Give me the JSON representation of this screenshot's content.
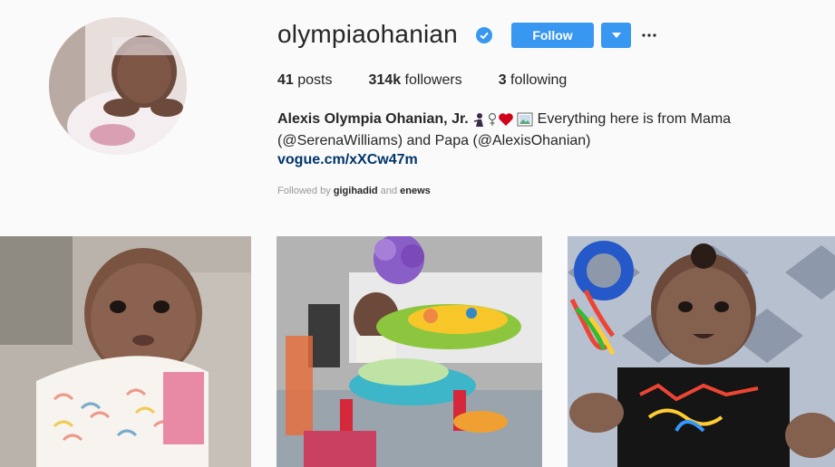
{
  "profile": {
    "username": "olympiaohanian",
    "follow_label": "Follow",
    "posts_count": "41",
    "posts_label": "posts",
    "followers_count": "314k",
    "followers_label": "followers",
    "following_count": "3",
    "following_label": "following",
    "full_name": "Alexis Olympia Ohanian, Jr.",
    "bio_line1": "Everything here is from Mama",
    "bio_line2": "(@SerenaWilliams) and Papa (@AlexisOhanian)",
    "link": "vogue.cm/xXCw47m",
    "followed_by_prefix": "Followed by",
    "followed_by_user1": "gigihadid",
    "followed_by_and": "and",
    "followed_by_user2": "enews"
  },
  "colors": {
    "accent": "#3897f0",
    "link": "#003569",
    "muted": "#999999",
    "background": "#fafafa"
  },
  "icons": [
    "verified-badge-icon",
    "chevron-down-icon",
    "more-options-icon",
    "ninja-emoji",
    "woman-symbol-emoji",
    "heart-emoji",
    "framed-picture-emoji"
  ],
  "posts": [
    {
      "description": "baby with bib photo"
    },
    {
      "description": "baby in activity center photo"
    },
    {
      "description": "baby in metallica shirt photo"
    }
  ]
}
